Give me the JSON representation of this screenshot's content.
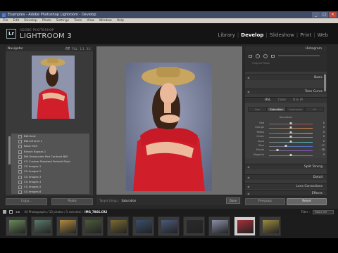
{
  "window": {
    "title": "Examples - Adobe Photoshop Lightroom - Develop",
    "menus": [
      "File",
      "Edit",
      "Develop",
      "Photo",
      "Settings",
      "Tools",
      "View",
      "Window",
      "Help"
    ],
    "buttons": [
      "_",
      "□",
      "✕"
    ]
  },
  "identity": {
    "badge": "Lr",
    "brand_small": "ADOBE PHOTOSHOP",
    "brand_big": "LIGHTROOM 3"
  },
  "modules": [
    {
      "label": "Library",
      "active": false
    },
    {
      "label": "Develop",
      "active": true
    },
    {
      "label": "Slideshow",
      "active": false
    },
    {
      "label": "Print",
      "active": false
    },
    {
      "label": "Web",
      "active": false
    }
  ],
  "navigator": {
    "title": "Navigator",
    "options": [
      "FIT",
      "FILL",
      "1:1",
      "3:1"
    ]
  },
  "presets": [
    "BW-Hard",
    "BW-Infrared 1",
    "Basic Rich",
    "Bleach Bypass 1",
    "BW-Desaturate Red Contrast BW",
    "CG Custom Standard Portrait Style",
    "CG Images 1",
    "CG Images 2",
    "CG Images 3",
    "CG Images 4",
    "CG Images 5",
    "CG Images 6"
  ],
  "left_buttons": {
    "copy": "Copy...",
    "paste": "Paste"
  },
  "center_toolbar": {
    "target_label": "Target Group :",
    "target_value": "Saturation",
    "done": "Done"
  },
  "right": {
    "histogram_title": "Histogram",
    "histogram_sub": "Original Photo",
    "sections_top": [
      "Basic",
      "Tone Curve"
    ],
    "hsl_tabs": [
      "Hue",
      "Saturation",
      "Luminance",
      "All"
    ],
    "hsl_tabs_header": [
      "HSL",
      "Color",
      "B & W"
    ],
    "hsl_active_tab": "Saturation",
    "hsl_group": "Saturation",
    "hsl_rows": [
      {
        "label": "Red",
        "value": "0",
        "pos": 0.5
      },
      {
        "label": "Orange",
        "value": "0",
        "pos": 0.5
      },
      {
        "label": "Yellow",
        "value": "0",
        "pos": 0.5
      },
      {
        "label": "Green",
        "value": "0",
        "pos": 0.5
      },
      {
        "label": "Aqua",
        "value": "0",
        "pos": 0.5
      },
      {
        "label": "Blue",
        "value": "- 17",
        "pos": 0.38
      },
      {
        "label": "Purple",
        "value": "- 38",
        "pos": 0.2
      },
      {
        "label": "Magenta",
        "value": "0",
        "pos": 0.5
      }
    ],
    "sections_bottom": [
      "Split Toning",
      "Detail",
      "Lens Corrections",
      "Effects"
    ],
    "buttons": {
      "previous": "Previous",
      "reset": "Reset"
    }
  },
  "filmstrip": {
    "info": "All Photographs / 12 photos / 1 selected /",
    "filename": "IMG_7866.CR2",
    "filter_label": "Filter :",
    "filter_value": "Filters Off",
    "selected_index": 9
  },
  "colors": {
    "hsl_tracks": [
      "#d24848",
      "#d2883a",
      "#c9c24a",
      "#55aa55",
      "#4fb6b6",
      "#4a6fd0",
      "#8a52c8",
      "#c04fb0"
    ],
    "thumbs": [
      "#6a8a5a",
      "#5c7a6a",
      "#b08a40",
      "#4b5a3a",
      "#7a6a30",
      "#3a4e6a",
      "#4a5a7a",
      "#2a2a2a",
      "#8a8fa8",
      "#a53038",
      "#9a8a40"
    ]
  }
}
